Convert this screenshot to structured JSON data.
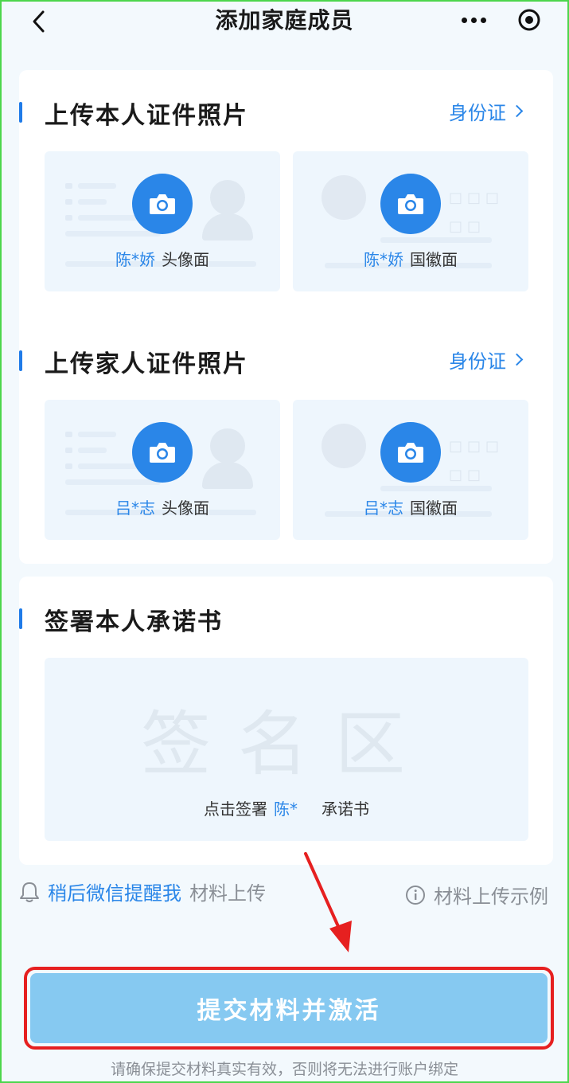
{
  "nav": {
    "title": "添加家庭成员",
    "back_icon": "chevron-left-icon",
    "more_icon": "more-dots-icon",
    "close_icon": "target-close-icon"
  },
  "self_section": {
    "title": "上传本人证件照片",
    "doc_type_link": "身份证",
    "front": {
      "name": "陈*娇",
      "side": "头像面"
    },
    "back": {
      "name": "陈*娇",
      "side": "国徽面"
    }
  },
  "family_section": {
    "title": "上传家人证件照片",
    "doc_type_link": "身份证",
    "front": {
      "name": "吕*志",
      "side": "头像面"
    },
    "back": {
      "name": "吕*志",
      "side": "国徽面"
    }
  },
  "sign_section": {
    "title": "签署本人承诺书",
    "watermark": "签名区",
    "hint_prefix": "点击签署",
    "hint_name": "陈*",
    "hint_suffix": "承诺书"
  },
  "remind": {
    "highlight": "稍后微信提醒我",
    "muted": "材料上传",
    "icon": "bell-icon"
  },
  "example_link": {
    "label": "材料上传示例",
    "icon": "info-icon"
  },
  "submit_label": "提交材料并激活",
  "disclaimer": "请确保提交材料真实有效，否则将无法进行账户绑定",
  "colors": {
    "accent": "#2a86e8",
    "submit_bg": "#86c9f1",
    "annotation_red": "#e62020"
  }
}
